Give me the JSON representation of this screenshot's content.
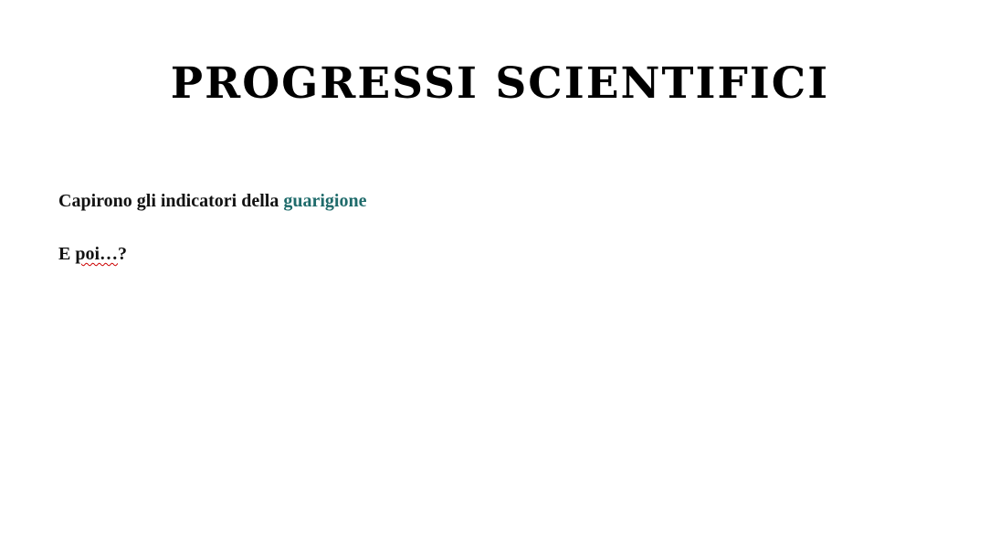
{
  "document": {
    "title": "PROGRESSI SCIENTIFICI",
    "paragraph1": {
      "text": "Capirono gli indicatori della ",
      "highlight": "guarigione",
      "highlight_color": "#1f6b6b"
    },
    "paragraph2": {
      "prefix": "E ",
      "misspelled": "poi…",
      "suffix": "?"
    }
  }
}
